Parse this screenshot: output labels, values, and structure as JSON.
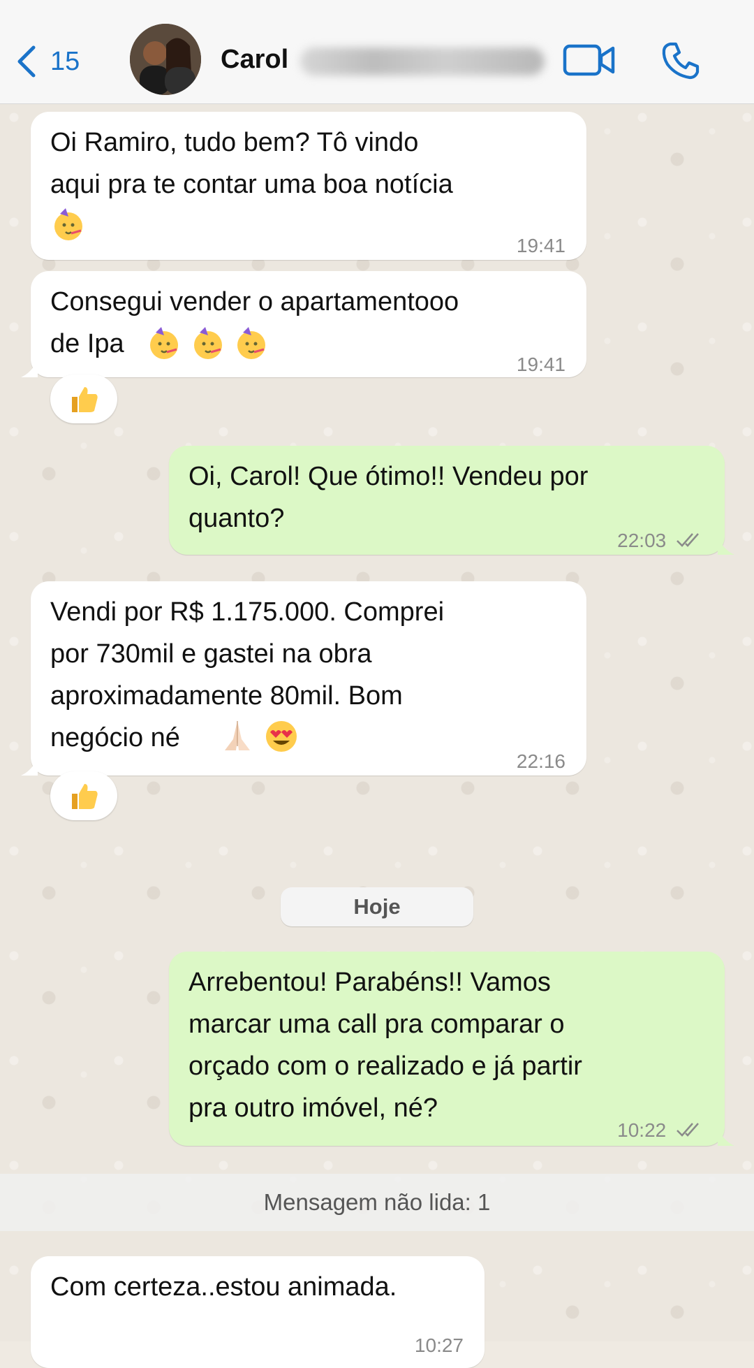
{
  "header": {
    "back_count": "15",
    "contact_name": "Carol",
    "accent_color": "#1a73c9"
  },
  "messages": [
    {
      "direction": "in",
      "text": "Oi Ramiro, tudo bem? Tô vindo\naqui pra te contar uma boa notícia",
      "emoji": "partying-face",
      "time": "19:41"
    },
    {
      "direction": "in",
      "text": "Consegui vender o apartamentooo\nde Ipa",
      "emoji": "partying-face x3",
      "time": "19:41",
      "reaction": "thumbs-up"
    },
    {
      "direction": "out",
      "text": "Oi, Carol! Que ótimo!! Vendeu por\nquanto?",
      "time": "22:03",
      "status": "read-double-check"
    },
    {
      "direction": "in",
      "text": "Vendi por R$ 1.175.000. Comprei\npor 730mil e  gastei na obra\naproximadamente 80mil. Bom\nnegócio né",
      "emoji": "folded-hands, heart-eyes",
      "time": "22:16",
      "reaction": "thumbs-up"
    },
    {
      "direction": "out",
      "text": "Arrebentou! Parabéns!! Vamos\nmarcar uma call pra comparar o\norçado com o realizado e já partir\npra outro imóvel, né?",
      "time": "10:22",
      "status": "read-double-check"
    },
    {
      "direction": "in",
      "text": "Com certeza..estou animada.",
      "time": "10:27"
    }
  ],
  "date_separator": "Hoje",
  "unread_banner": "Mensagem não lida: 1",
  "colors": {
    "incoming_bubble": "#ffffff",
    "outgoing_bubble": "#dcf8c6",
    "chat_background": "#ece7df"
  }
}
